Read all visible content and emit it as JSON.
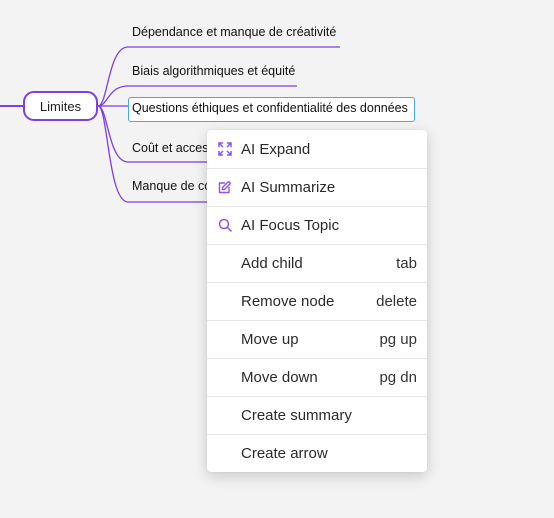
{
  "mindmap": {
    "root": {
      "label": "Limites"
    },
    "branches": [
      {
        "label": "Dépendance et manque de créativité"
      },
      {
        "label": "Biais algorithmiques et équité"
      },
      {
        "label": "Questions éthiques et confidentialité des données"
      },
      {
        "label": "Coût et accessibilité"
      },
      {
        "label": "Manque de compréhension contextuelle"
      }
    ],
    "accent_color": "#7b3fe4",
    "selection_color": "#4aa8e8"
  },
  "context_menu": {
    "items": [
      {
        "label": "AI Expand",
        "icon": "expand-icon",
        "shortcut": ""
      },
      {
        "label": "AI Summarize",
        "icon": "edit-icon",
        "shortcut": ""
      },
      {
        "label": "AI Focus Topic",
        "icon": "search-icon",
        "shortcut": ""
      },
      {
        "label": "Add child",
        "shortcut": "tab"
      },
      {
        "label": "Remove node",
        "shortcut": "delete"
      },
      {
        "label": "Move up",
        "shortcut": "pg up"
      },
      {
        "label": "Move down",
        "shortcut": "pg dn"
      },
      {
        "label": "Create summary",
        "shortcut": ""
      },
      {
        "label": "Create arrow",
        "shortcut": ""
      }
    ]
  }
}
